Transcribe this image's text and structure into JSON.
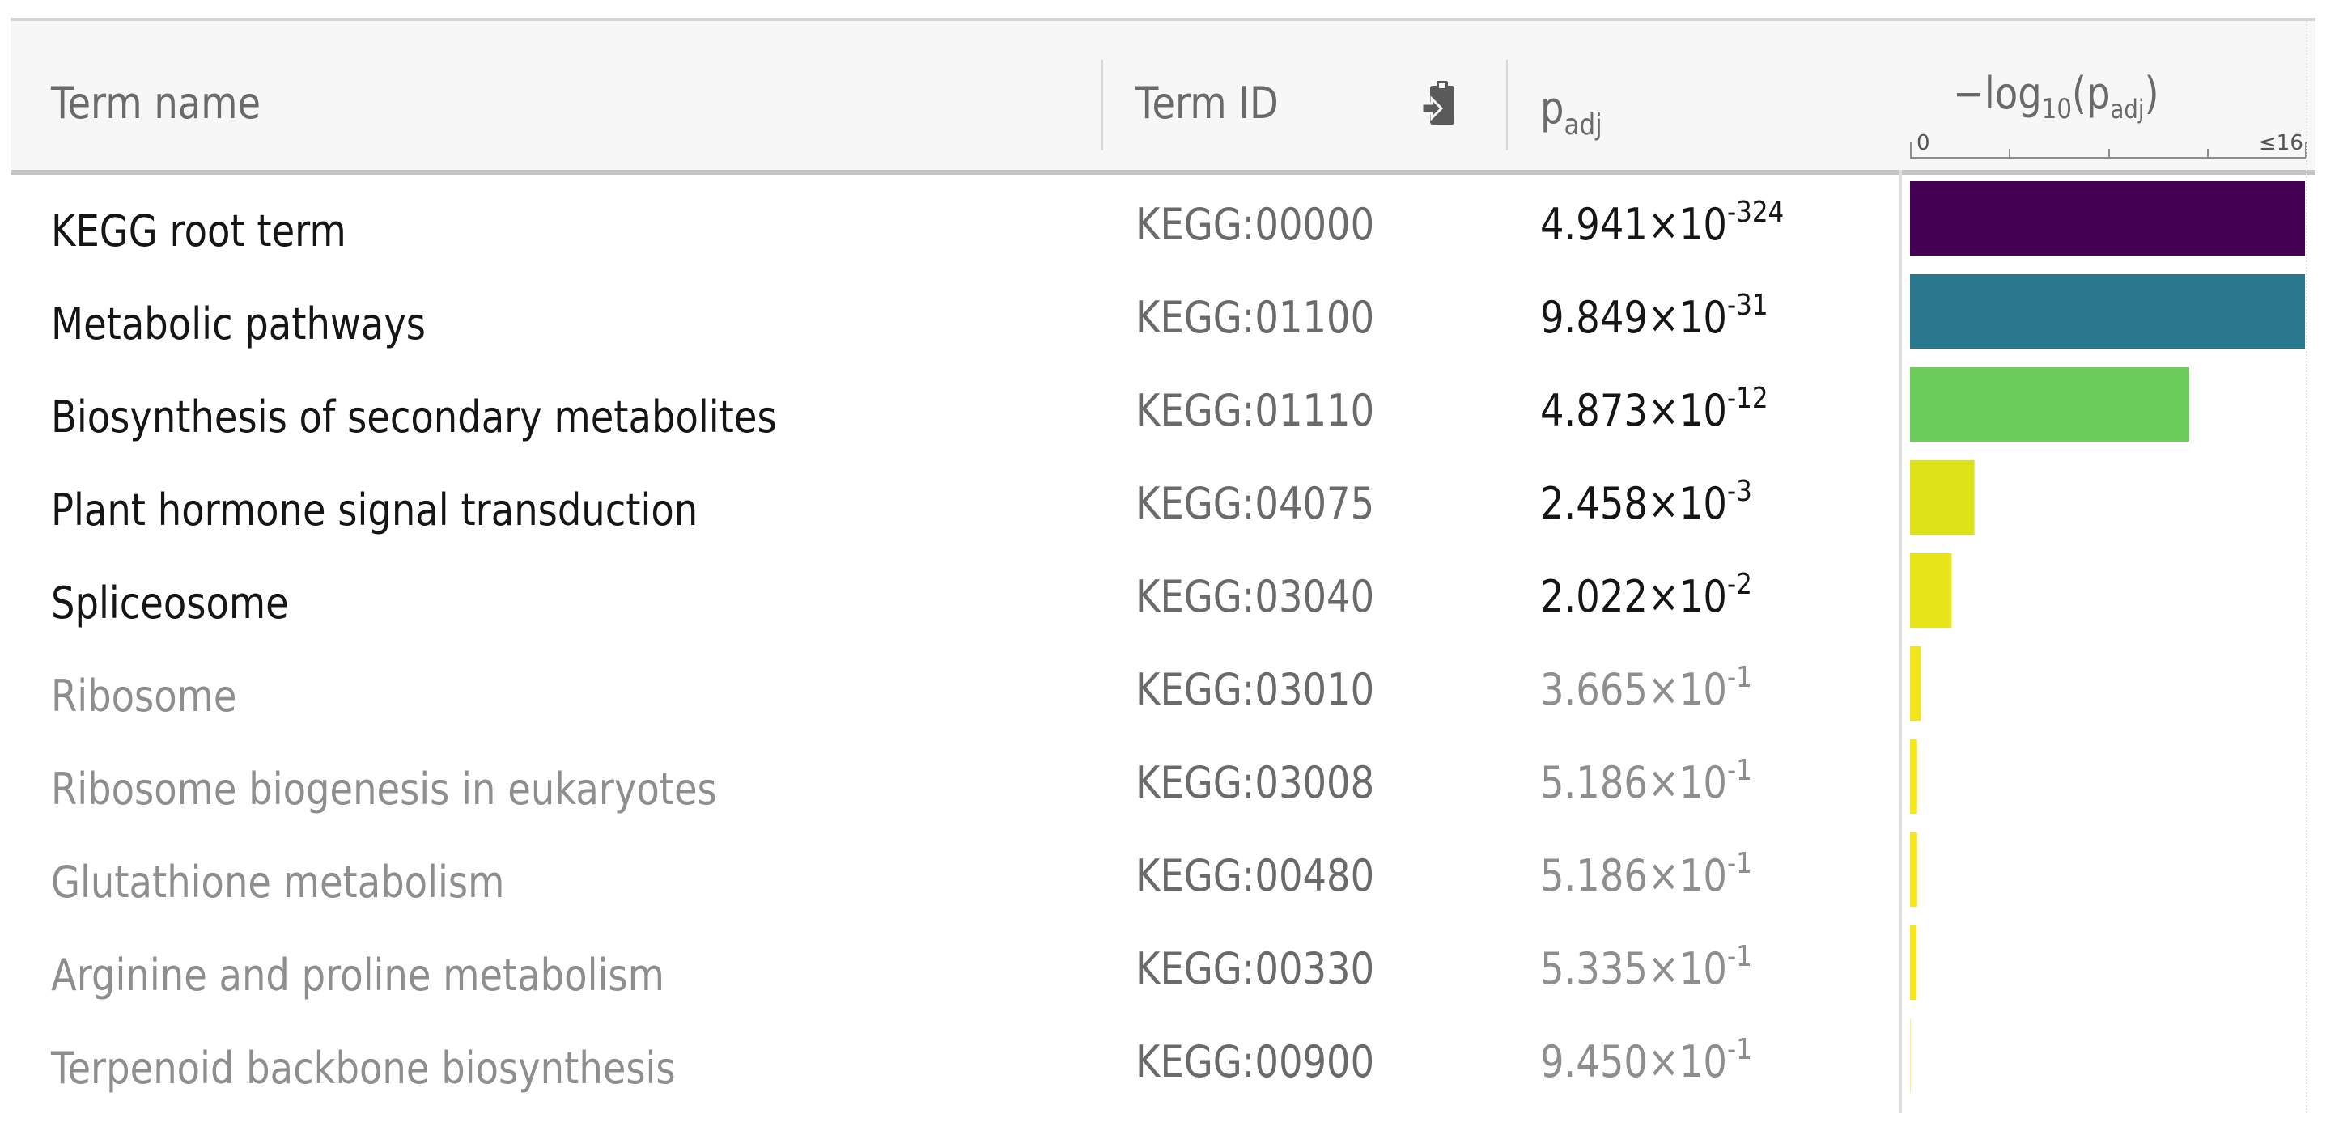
{
  "table": {
    "columns": {
      "term_name": "Term name",
      "term_id": "Term ID",
      "padj_main": "p",
      "padj_sub": "adj",
      "nlp_prefix": "−log",
      "nlp_sub": "10",
      "nlp_open": "(p",
      "nlp_sub2": "adj",
      "nlp_close": ")"
    },
    "axis": {
      "min_label": "0",
      "max_label": "≤16"
    },
    "icons": {
      "paste": "clipboard-paste-icon"
    },
    "rows": [
      {
        "name": "KEGG root term",
        "id": "KEGG:00000",
        "p_mant": "4.941×10",
        "p_exp": "-324",
        "significant": true
      },
      {
        "name": "Metabolic pathways",
        "id": "KEGG:01100",
        "p_mant": "9.849×10",
        "p_exp": "-31",
        "significant": true
      },
      {
        "name": "Biosynthesis of secondary metabolites",
        "id": "KEGG:01110",
        "p_mant": "4.873×10",
        "p_exp": "-12",
        "significant": true
      },
      {
        "name": "Plant hormone signal transduction",
        "id": "KEGG:04075",
        "p_mant": "2.458×10",
        "p_exp": "-3",
        "significant": true
      },
      {
        "name": "Spliceosome",
        "id": "KEGG:03040",
        "p_mant": "2.022×10",
        "p_exp": "-2",
        "significant": true
      },
      {
        "name": "Ribosome",
        "id": "KEGG:03010",
        "p_mant": "3.665×10",
        "p_exp": "-1",
        "significant": false
      },
      {
        "name": "Ribosome biogenesis in eukaryotes",
        "id": "KEGG:03008",
        "p_mant": "5.186×10",
        "p_exp": "-1",
        "significant": false
      },
      {
        "name": "Glutathione metabolism",
        "id": "KEGG:00480",
        "p_mant": "5.186×10",
        "p_exp": "-1",
        "significant": false
      },
      {
        "name": "Arginine and proline metabolism",
        "id": "KEGG:00330",
        "p_mant": "5.335×10",
        "p_exp": "-1",
        "significant": false
      },
      {
        "name": "Terpenoid backbone biosynthesis",
        "id": "KEGG:00900",
        "p_mant": "9.450×10",
        "p_exp": "-1",
        "significant": false
      }
    ]
  },
  "chart_data": {
    "type": "bar",
    "categories": [
      "KEGG:00000",
      "KEGG:01100",
      "KEGG:01110",
      "KEGG:04075",
      "KEGG:03040",
      "KEGG:03010",
      "KEGG:03008",
      "KEGG:00480",
      "KEGG:00330",
      "KEGG:00900"
    ],
    "values": [
      16,
      16,
      11.31,
      2.61,
      1.69,
      0.44,
      0.29,
      0.29,
      0.27,
      0.02
    ],
    "colors": [
      "#440154",
      "#2a788e",
      "#6ccd5a",
      "#dde318",
      "#e7e419",
      "#f3e51c",
      "#f5e61d",
      "#f5e61d",
      "#f5e61d",
      "#fde725"
    ],
    "xlim": [
      0,
      16
    ],
    "orientation": "horizontal"
  }
}
